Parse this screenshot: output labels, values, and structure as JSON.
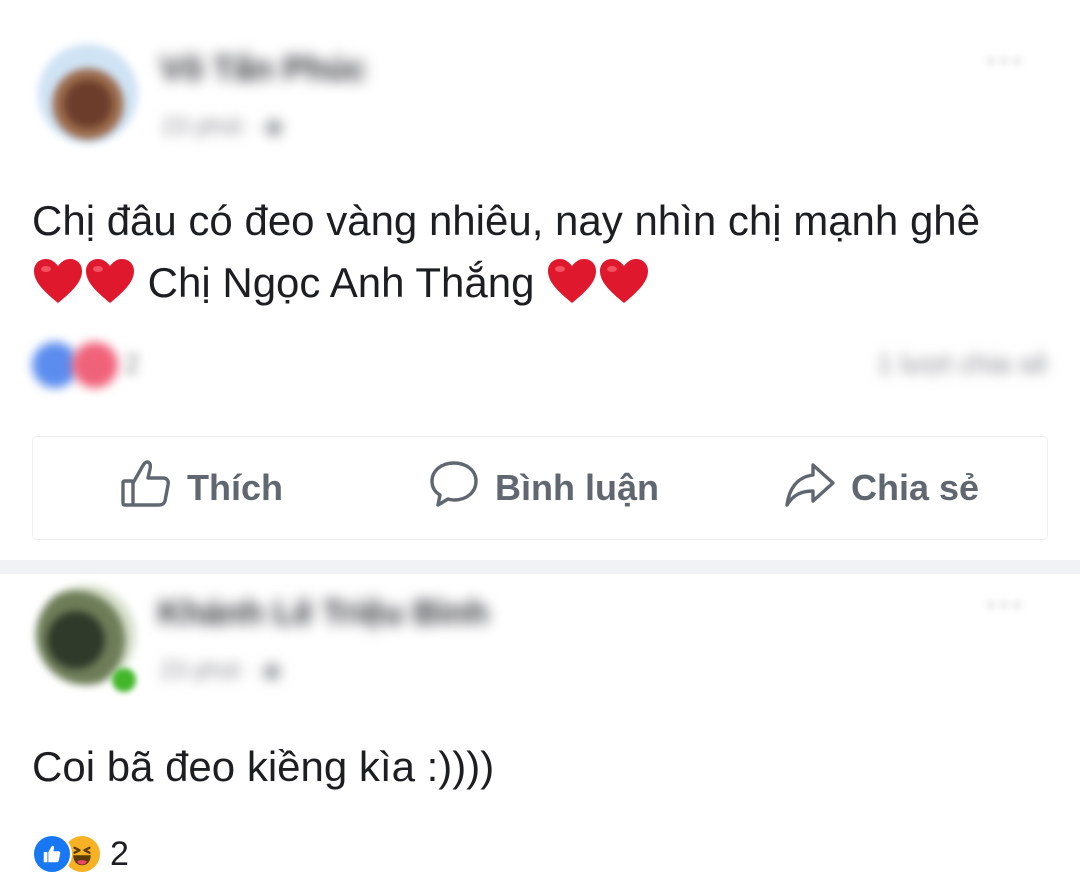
{
  "post1": {
    "author_name": "Võ Tấn Phúc",
    "meta": "23 phút · ◉",
    "more": "···",
    "text_line1": "Chị đâu có đeo vàng nhiêu, nay nhìn chị mạnh ghê",
    "text_line2_name": "Chị Ngọc Anh Thắng",
    "reaction_count": "2",
    "shares": "1 lượt chia sẻ"
  },
  "actions": {
    "like_label": "Thích",
    "comment_label": "Bình luận",
    "share_label": "Chia sẻ"
  },
  "post2": {
    "author_name": "Khánh Lê Triệu Bình",
    "meta": "23 phút · ◉",
    "more": "···",
    "text": "Coi bã đeo kiềng kìa :))))",
    "reaction_count": "2"
  },
  "icons": {
    "heart": "red-heart-icon",
    "like": "thumbs-up-icon",
    "comment": "speech-bubble-icon",
    "share": "share-arrow-icon",
    "haha": "laughing-face-icon"
  },
  "colors": {
    "facebook_blue": "#1877f2",
    "heart_red": "#e0182d",
    "action_gray": "#606770",
    "haha_yellow": "#f7b125"
  }
}
